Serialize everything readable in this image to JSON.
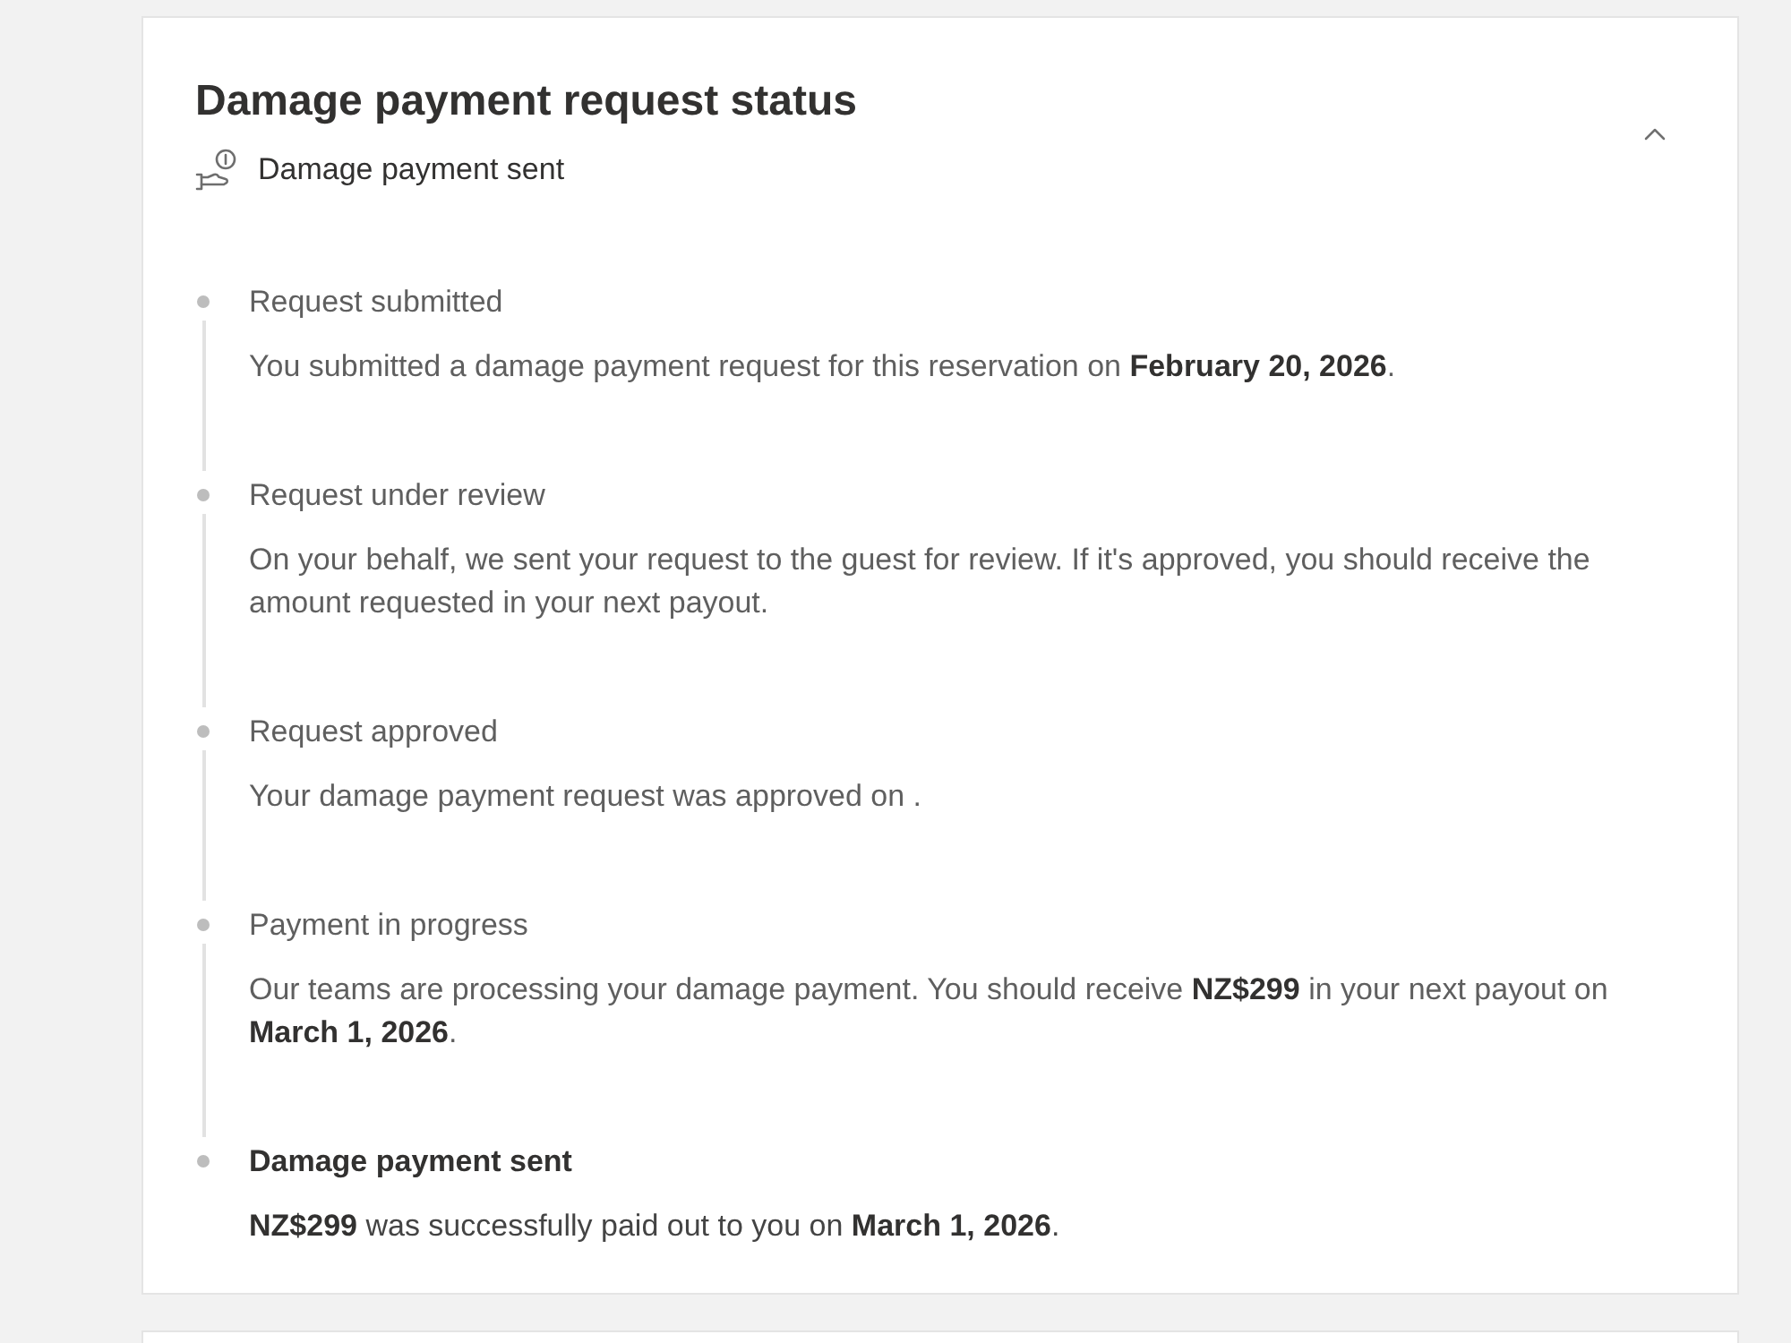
{
  "panel": {
    "title": "Damage payment request status",
    "status": "Damage payment sent",
    "expanded": true
  },
  "steps": [
    {
      "title": "Request submitted",
      "description": "You submitted a damage payment request for this reservation on **February 20, 2026**.",
      "current": false
    },
    {
      "title": "Request under review",
      "description": "On your behalf, we sent your request to the guest for review. If it's approved, you should receive the amount requested in your next payout.",
      "current": false
    },
    {
      "title": "Request approved",
      "description": "Your damage payment request was approved on .",
      "current": false
    },
    {
      "title": "Payment in progress",
      "description": "Our teams are processing your damage payment. You should receive **NZ$299** in your next payout on **March 1, 2026**.",
      "current": false
    },
    {
      "title": "Damage payment sent",
      "description": "**NZ$299** was successfully paid out to you on **March 1, 2026**.",
      "current": true
    }
  ]
}
